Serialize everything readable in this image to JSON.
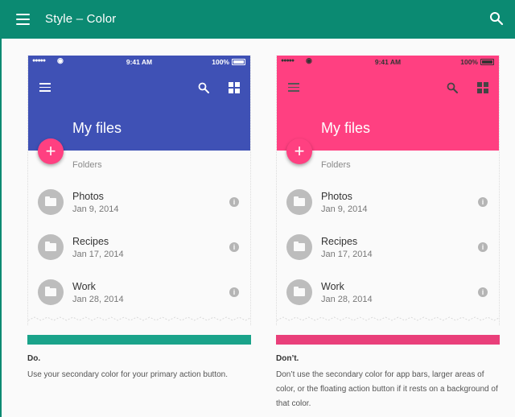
{
  "header": {
    "title": "Style  –  Color",
    "bg": "#0b8a72"
  },
  "examples": [
    {
      "primary": "#3f51b5",
      "accent": "#ff4081",
      "status": {
        "signal": "●●●●●",
        "time": "9:41 AM",
        "battery": "100%"
      },
      "title": "My files",
      "fab": "+",
      "section": "Folders",
      "items": [
        {
          "name": "Photos",
          "date": "Jan 9, 2014"
        },
        {
          "name": "Recipes",
          "date": "Jan 17, 2014"
        },
        {
          "name": "Work",
          "date": "Jan 28, 2014"
        }
      ],
      "swatch": "#1aa38a",
      "caption_title": "Do.",
      "caption_text": "Use your secondary color for your primary action button."
    },
    {
      "primary": "#ff4081",
      "accent": "#ff4081",
      "status": {
        "signal": "●●●●●",
        "time": "9:41 AM",
        "battery": "100%"
      },
      "title": "My files",
      "fab": "+",
      "section": "Folders",
      "items": [
        {
          "name": "Photos",
          "date": "Jan 9, 2014"
        },
        {
          "name": "Recipes",
          "date": "Jan 17, 2014"
        },
        {
          "name": "Work",
          "date": "Jan 28, 2014"
        }
      ],
      "swatch": "#e93f7a",
      "caption_title": "Don’t.",
      "caption_text": "Don’t use the secondary color for app bars, larger areas of color, or the floating action button if it rests on a background of that color."
    }
  ]
}
